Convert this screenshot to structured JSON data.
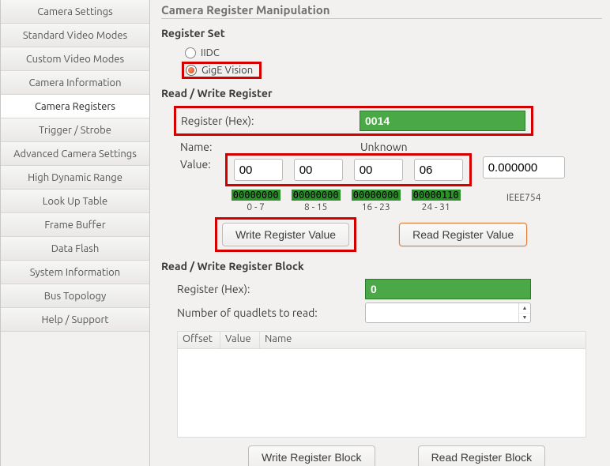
{
  "sidebar": {
    "items": [
      {
        "label": "Camera Settings"
      },
      {
        "label": "Standard Video Modes"
      },
      {
        "label": "Custom Video Modes"
      },
      {
        "label": "Camera Information"
      },
      {
        "label": "Camera Registers"
      },
      {
        "label": "Trigger / Strobe"
      },
      {
        "label": "Advanced Camera Settings"
      },
      {
        "label": "High Dynamic Range"
      },
      {
        "label": "Look Up Table"
      },
      {
        "label": "Frame Buffer"
      },
      {
        "label": "Data Flash"
      },
      {
        "label": "System Information"
      },
      {
        "label": "Bus Topology"
      },
      {
        "label": "Help / Support"
      }
    ],
    "active_index": 4
  },
  "page": {
    "title": "Camera Register Manipulation",
    "register_set": {
      "heading": "Register Set",
      "options": [
        "IIDC",
        "GigE Vision"
      ],
      "selected": "GigE Vision"
    },
    "rw": {
      "heading": "Read / Write Register",
      "reg_hex_label": "Register (Hex):",
      "reg_hex_value": "0014",
      "name_label": "Name:",
      "name_value": "Unknown",
      "value_label": "Value:",
      "octets": [
        "00",
        "00",
        "00",
        "06"
      ],
      "bits": [
        "00000000",
        "00000000",
        "00000000",
        "00000110"
      ],
      "ranges": [
        "0 - 7",
        "8 - 15",
        "16 - 23",
        "24 - 31"
      ],
      "ieee_value": "0.000000",
      "ieee_label": "IEEE754",
      "write_btn": "Write Register Value",
      "read_btn": "Read Register Value"
    },
    "block": {
      "heading": "Read / Write Register Block",
      "reg_hex_label": "Register (Hex):",
      "reg_hex_value": "0",
      "num_quadlets_label": "Number of quadlets to read:",
      "num_quadlets_value": "",
      "columns": [
        "Offset",
        "Value",
        "Name"
      ],
      "write_btn": "Write Register Block",
      "read_btn": "Read Register Block"
    }
  }
}
